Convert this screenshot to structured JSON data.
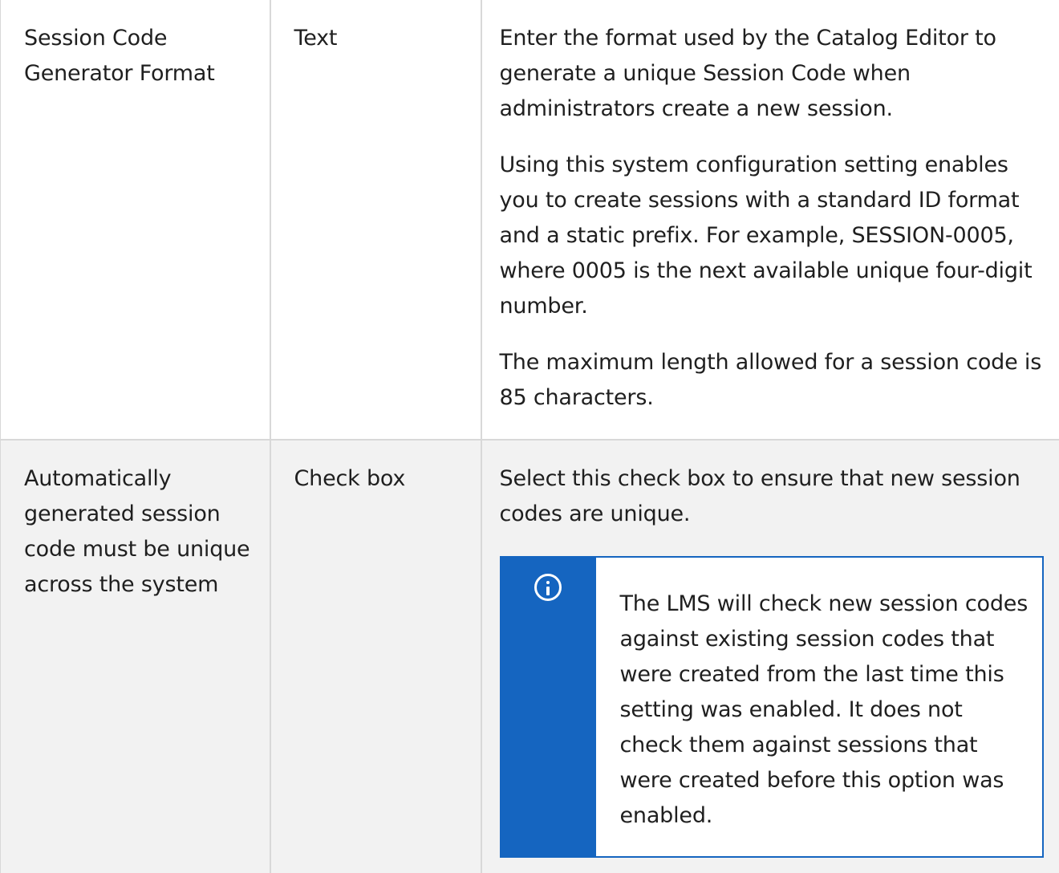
{
  "rows": [
    {
      "name": "Session Code Generator Format",
      "type": "Text",
      "paragraphs": [
        "Enter the format used by the Catalog Editor to generate a unique Session Code when administrators create a new session.",
        "Using this system configuration setting enables you to create sessions with a standard ID format and a static prefix. For example, SESSION-0005, where 0005 is the next available unique four-digit number.",
        "The maximum length allowed for a session code is 85 characters."
      ]
    },
    {
      "name": "Automatically generated session code must be unique across the system",
      "type": "Check box",
      "paragraphs": [
        "Select this check box to ensure that new session codes are unique."
      ],
      "note": {
        "icon": "info-icon",
        "text": "The LMS will check new session codes against existing session codes that were created from the last time this setting was enabled. It does not check them against sessions that were created before this option was enabled."
      }
    }
  ],
  "colors": {
    "note_accent": "#1565c0",
    "row_alt_bg": "#f2f2f2",
    "border": "#d8d8d8"
  }
}
